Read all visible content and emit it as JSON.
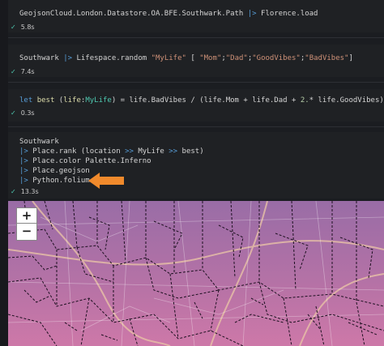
{
  "cells": [
    {
      "line": [
        "GeojsonCloud.London.Datastore.OA.BFE.Southwark.Path",
        " |> ",
        "Florence.load"
      ],
      "time": "5.8s"
    },
    {
      "line": [
        "Southwark",
        " |> ",
        "Lifespace.random ",
        "\"MyLife\"",
        " [ ",
        "\"Mom\"",
        ";",
        "\"Dad\"",
        ";",
        "\"GoodVibes\"",
        ";",
        "\"BadVibes\"",
        "]"
      ],
      "time": "7.4s"
    },
    {
      "line": [
        "let ",
        "best ",
        "(",
        "life",
        ":",
        "MyLife",
        ") = life.BadVibes / (life.Mom + life.Dad + ",
        "2.",
        "* life.GoodVibes)"
      ],
      "time": "0.3s"
    },
    {
      "lines": [
        [
          "Southwark"
        ],
        [
          "|> ",
          "Place.rank (location ",
          ">>",
          " MyLife ",
          ">>",
          " best)"
        ],
        [
          "|> ",
          "Place.color Palette.Inferno"
        ],
        [
          "|> ",
          "Place.geojson"
        ],
        [
          "|> ",
          "Python.folium"
        ]
      ],
      "time": "13.3s"
    }
  ],
  "map": {
    "zoom_in": "+",
    "zoom_out": "−"
  },
  "colors": {
    "arrow": "#f08a2c",
    "check": "#4ec9b0"
  }
}
